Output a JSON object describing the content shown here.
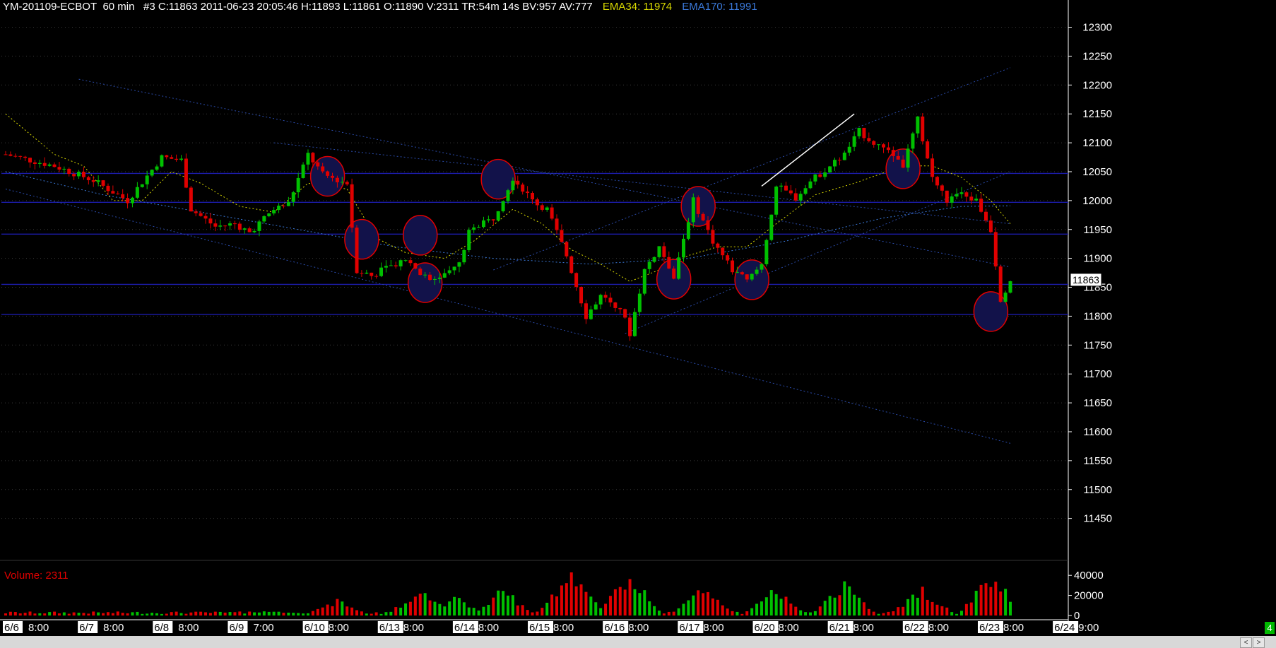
{
  "header": {
    "symbol": "YM-201109-ECBOT",
    "interval": "60 min",
    "info": "#3 C:11863 2011-06-23 20:05:46 H:11893 L:11861 O:11890 V:2311 TR:54m 14s BV:957 AV:777",
    "ema34_label": "EMA34: 11974",
    "ema170_label": "EMA170: 11991"
  },
  "volume_label": "Volume: 2311",
  "status_badge": "4",
  "colors": {
    "background": "#000000",
    "up_candle": "#00c000",
    "down_candle": "#e00000",
    "ema34": "#d8d800",
    "ema170": "#3a78d8",
    "grid": "#3a3a3a",
    "axis_text": "#ffffff",
    "horizontal_levels": "#1c1caa",
    "highlight_circle_fill": "#12124a",
    "highlight_circle_stroke": "#e00000",
    "trendline": "#ffffff"
  },
  "chart_data": {
    "type": "candlestick",
    "price_axis": {
      "ticks": [
        12300,
        12250,
        12200,
        12150,
        12100,
        12050,
        12000,
        11950,
        11900,
        11850,
        11800,
        11750,
        11700,
        11650,
        11600,
        11550,
        11500,
        11450
      ],
      "range": [
        11430,
        12330
      ],
      "last_price_label": "11863"
    },
    "volume_axis": {
      "ticks": [
        "40000",
        "20000",
        "0"
      ],
      "range": [
        0,
        50000
      ]
    },
    "time_axis": {
      "labels": [
        "6/6",
        "8:00",
        "6/7",
        "8:00",
        "6/8",
        "8:00",
        "6/9",
        "7:00",
        "6/10",
        "8:00",
        "6/13",
        "8:00",
        "6/14",
        "8:00",
        "6/15",
        "8:00",
        "6/16",
        "8:00",
        "6/17",
        "8:00",
        "6/20",
        "8:00",
        "6/21",
        "8:00",
        "6/22",
        "8:00",
        "6/23",
        "8:00",
        "6/24",
        "9:00"
      ],
      "bars_total": 207
    },
    "horizontal_levels": [
      12047,
      11997,
      11942,
      11855,
      11803
    ],
    "price_path": [
      [
        0,
        12080
      ],
      [
        10,
        12060
      ],
      [
        18,
        12035
      ],
      [
        25,
        12000
      ],
      [
        32,
        12075
      ],
      [
        36,
        12070
      ],
      [
        38,
        11985
      ],
      [
        43,
        11955
      ],
      [
        47,
        11960
      ],
      [
        50,
        11945
      ],
      [
        55,
        11985
      ],
      [
        58,
        11995
      ],
      [
        62,
        12080
      ],
      [
        65,
        12045
      ],
      [
        70,
        12030
      ],
      [
        72,
        11880
      ],
      [
        75,
        11870
      ],
      [
        82,
        11900
      ],
      [
        87,
        11860
      ],
      [
        93,
        11890
      ],
      [
        95,
        11945
      ],
      [
        100,
        11970
      ],
      [
        104,
        12040
      ],
      [
        108,
        12000
      ],
      [
        111,
        11985
      ],
      [
        115,
        11905
      ],
      [
        119,
        11800
      ],
      [
        122,
        11835
      ],
      [
        126,
        11815
      ],
      [
        128,
        11770
      ],
      [
        131,
        11880
      ],
      [
        134,
        11920
      ],
      [
        137,
        11870
      ],
      [
        141,
        12000
      ],
      [
        145,
        11930
      ],
      [
        149,
        11880
      ],
      [
        152,
        11860
      ],
      [
        155,
        11890
      ],
      [
        158,
        12025
      ],
      [
        162,
        12005
      ],
      [
        166,
        12040
      ],
      [
        172,
        12080
      ],
      [
        175,
        12120
      ],
      [
        178,
        12100
      ],
      [
        182,
        12080
      ],
      [
        184,
        12060
      ],
      [
        187,
        12140
      ],
      [
        190,
        12040
      ],
      [
        193,
        12000
      ],
      [
        196,
        12010
      ],
      [
        199,
        12000
      ],
      [
        202,
        11950
      ],
      [
        204,
        11830
      ],
      [
        206,
        11863
      ]
    ],
    "volume_peaks": [
      [
        55,
        6000
      ],
      [
        68,
        17000
      ],
      [
        85,
        30000
      ],
      [
        92,
        21000
      ],
      [
        102,
        29000
      ],
      [
        116,
        54000
      ],
      [
        128,
        46000
      ],
      [
        143,
        31000
      ],
      [
        158,
        30000
      ],
      [
        172,
        36000
      ],
      [
        188,
        30000
      ],
      [
        202,
        47000
      ]
    ],
    "ema34_path": [
      [
        0,
        12150
      ],
      [
        10,
        12080
      ],
      [
        16,
        12060
      ],
      [
        22,
        12000
      ],
      [
        28,
        12000
      ],
      [
        34,
        12050
      ],
      [
        40,
        12030
      ],
      [
        48,
        11990
      ],
      [
        55,
        11980
      ],
      [
        62,
        12030
      ],
      [
        70,
        12020
      ],
      [
        76,
        11935
      ],
      [
        82,
        11910
      ],
      [
        90,
        11900
      ],
      [
        96,
        11930
      ],
      [
        104,
        11985
      ],
      [
        110,
        11960
      ],
      [
        116,
        11915
      ],
      [
        122,
        11890
      ],
      [
        128,
        11860
      ],
      [
        134,
        11880
      ],
      [
        140,
        11905
      ],
      [
        146,
        11920
      ],
      [
        152,
        11920
      ],
      [
        158,
        11960
      ],
      [
        166,
        12010
      ],
      [
        174,
        12030
      ],
      [
        180,
        12048
      ],
      [
        186,
        12060
      ],
      [
        190,
        12060
      ],
      [
        196,
        12040
      ],
      [
        202,
        12000
      ],
      [
        206,
        11960
      ]
    ],
    "ema170_path": [
      [
        0,
        12050
      ],
      [
        20,
        12010
      ],
      [
        40,
        11980
      ],
      [
        60,
        11950
      ],
      [
        80,
        11920
      ],
      [
        100,
        11900
      ],
      [
        120,
        11890
      ],
      [
        140,
        11900
      ],
      [
        160,
        11930
      ],
      [
        180,
        11970
      ],
      [
        196,
        11990
      ],
      [
        206,
        11991
      ]
    ],
    "trend_lines": [
      {
        "from": [
          15,
          12210
        ],
        "to": [
          206,
          11885
        ]
      },
      {
        "from": [
          0,
          12020
        ],
        "to": [
          206,
          11580
        ]
      },
      {
        "from": [
          55,
          12100
        ],
        "to": [
          206,
          11960
        ]
      },
      {
        "from": [
          100,
          11880
        ],
        "to": [
          206,
          12230
        ]
      },
      {
        "from": [
          127,
          11770
        ],
        "to": [
          206,
          12050
        ]
      },
      {
        "from": [
          155,
          12025
        ],
        "to": [
          174,
          12150
        ],
        "color": "white"
      }
    ],
    "highlight_circles": [
      {
        "bar": 66,
        "price": 12042
      },
      {
        "bar": 73,
        "price": 11933
      },
      {
        "bar": 85,
        "price": 11940
      },
      {
        "bar": 86,
        "price": 11858
      },
      {
        "bar": 101,
        "price": 12037
      },
      {
        "bar": 137,
        "price": 11864
      },
      {
        "bar": 142,
        "price": 11990
      },
      {
        "bar": 153,
        "price": 11863
      },
      {
        "bar": 184,
        "price": 12055
      },
      {
        "bar": 202,
        "price": 11808
      }
    ]
  }
}
